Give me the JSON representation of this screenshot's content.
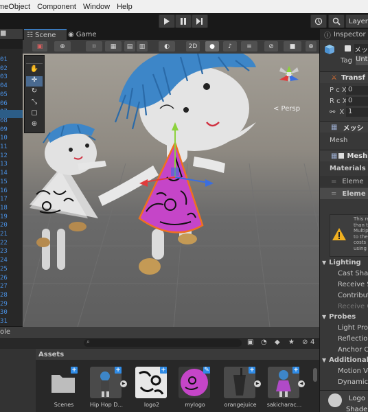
{
  "menu": [
    "meObject",
    "Component",
    "Window",
    "Help"
  ],
  "toolbar": {
    "layers_label": "Layers",
    "history_icon": "history-icon",
    "search_icon": "search-icon"
  },
  "hierarchy": {
    "line_numbers": [
      "01",
      "02",
      "03",
      "04",
      "05",
      "06",
      "07",
      "08",
      "09",
      "10",
      "11",
      "12",
      "13",
      "14",
      "15",
      "16",
      "17",
      "18",
      "19",
      "20",
      "21",
      "22",
      "23",
      "24",
      "25",
      "26",
      "27",
      "28",
      "29",
      "30",
      "31"
    ]
  },
  "scene_tabs": {
    "scene": "Scene",
    "game": "Game"
  },
  "scene_toolbar": {
    "mode_2d": "2D",
    "persp": "< Persp"
  },
  "inspector": {
    "title": "Inspector",
    "object_name": "メッシ",
    "tag_label": "Tag",
    "tag_value": "Unt",
    "transform": "Transf",
    "pos_label": "P c X",
    "pos_value": "0",
    "rot_label": "R c X",
    "rot_value": "0",
    "scale_label": "X",
    "scale_value": "1",
    "mesh_filter": "メッシ",
    "mesh_label": "Mesh",
    "mesh_renderer": "Mesh",
    "materials": "Materials",
    "element_0": "Eleme",
    "element_1": "Eleme",
    "warning_lines": [
      "This ren",
      "than th",
      "Multiple",
      "to the s",
      "costs p",
      "using m"
    ],
    "lighting": "Lighting",
    "cast_shadows": "Cast Shac",
    "receive_shadows": "Receive S",
    "contribute_gi": "Contribute",
    "receive_gi": "Receive G",
    "probes": "Probes",
    "light_probes": "Light Prob",
    "reflection": "Reflection",
    "anchor": "Anchor Ov",
    "additional": "Additional S",
    "motion": "Motion Ve",
    "dynamic": "Dynamic C",
    "logo": "Logo",
    "shader": "Shade"
  },
  "project": {
    "tab": "ole",
    "assets_title": "Assets",
    "badge_count": "4",
    "items": [
      "Scenes",
      "Hip Hop D...",
      "logo2",
      "mylogo",
      "orangejuice",
      "sakicharac..."
    ]
  },
  "colors": {
    "accent": "#2f8be6",
    "panel": "#383838",
    "selection_orange": "#f07020",
    "skirt_magenta": "#c545c8",
    "hair_blue": "#3d86c8"
  }
}
